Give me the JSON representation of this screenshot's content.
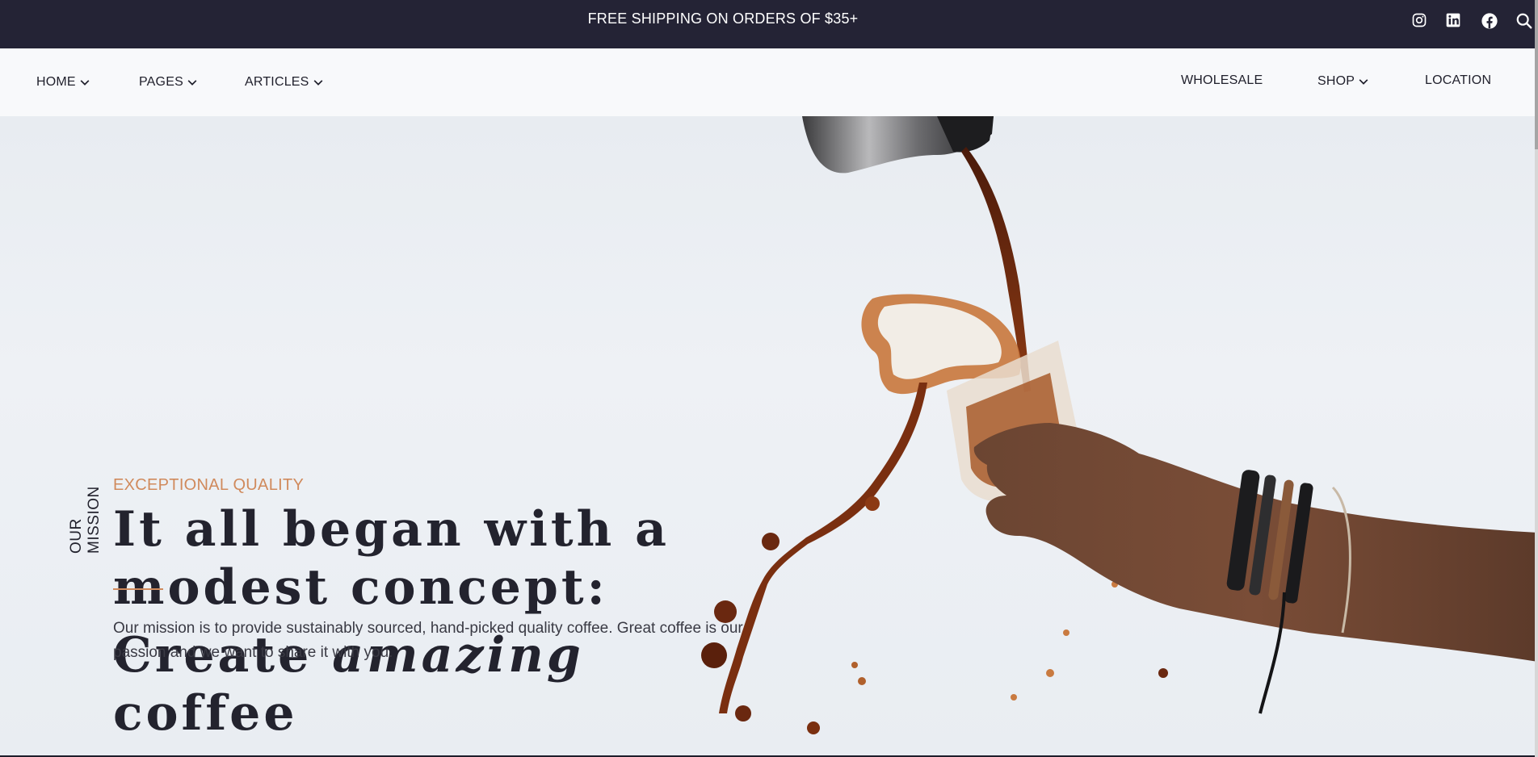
{
  "topbar": {
    "promo": "FREE SHIPPING ON ORDERS OF $35+",
    "social": [
      {
        "icon": "instagram-icon"
      },
      {
        "icon": "linkedin-icon"
      },
      {
        "icon": "facebook-icon"
      },
      {
        "icon": "search-icon"
      }
    ]
  },
  "nav": {
    "left": [
      {
        "label": "HOME",
        "dropdown": true
      },
      {
        "label": "PAGES",
        "dropdown": true
      },
      {
        "label": "ARTICLES",
        "dropdown": true
      }
    ],
    "right": [
      {
        "label": "WHOLESALE",
        "dropdown": false
      },
      {
        "label": "SHOP",
        "dropdown": true
      },
      {
        "label": "LOCATION",
        "dropdown": false
      }
    ]
  },
  "hero": {
    "side_label": "OUR MISSION",
    "eyebrow": "EXCEPTIONAL QUALITY",
    "headline_line1": "It all began with a",
    "headline_line2": "modest concept:",
    "headline_line3_a": "Create",
    "headline_line3_em": "amazing",
    "headline_line3_b": "coffee",
    "body": "Our mission is to provide sustainably sourced, hand-picked quality coffee. Great coffee is our passion and we want to share it with you."
  },
  "colors": {
    "topbar_bg": "#242335",
    "accent": "#d08a5c",
    "text_dark": "#23232e"
  }
}
